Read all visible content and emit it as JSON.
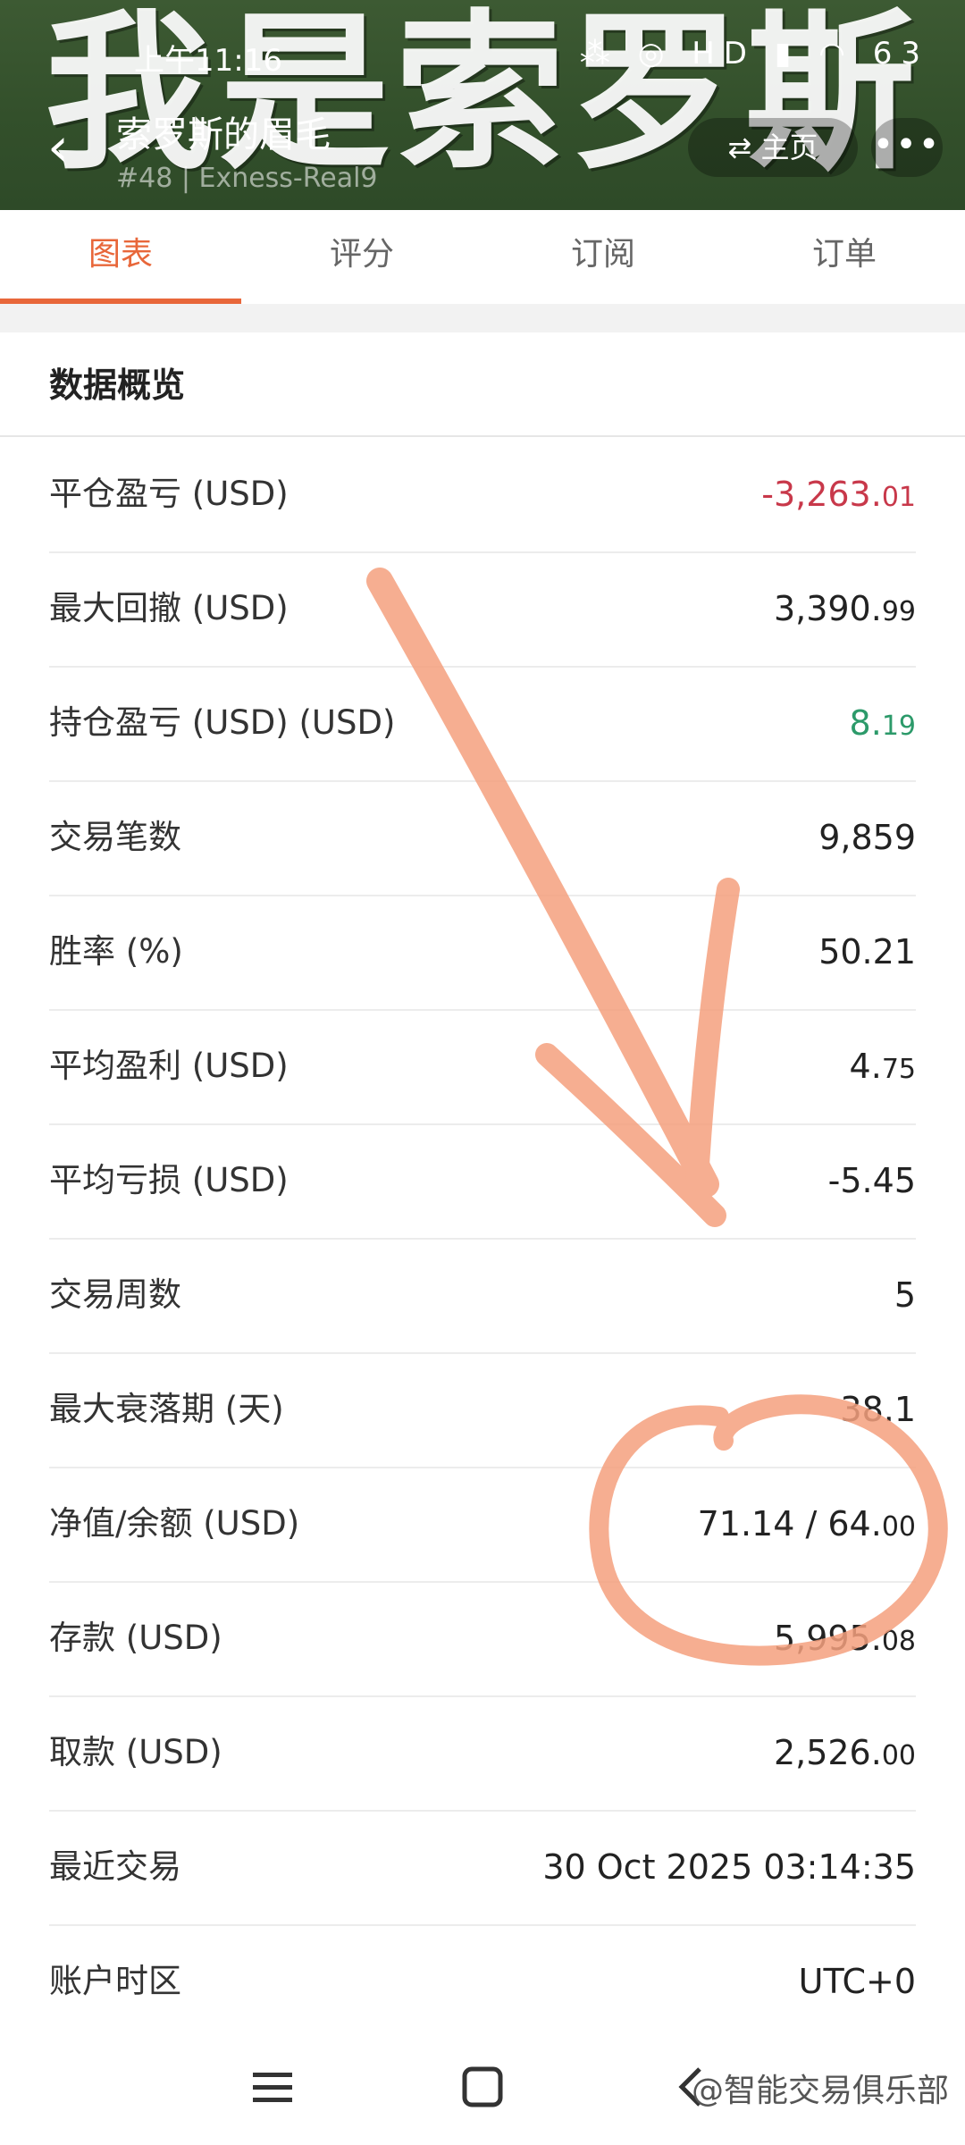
{
  "header": {
    "watermark": "我是索罗斯",
    "status_time": "上午11:16",
    "status_icons": "⁂ ◎ HD ▮ ◠ 63",
    "title": "索罗斯的眉毛",
    "subtitle": "#48 | Exness-Real9",
    "home_label": "主页",
    "more_label": "•••",
    "back_icon": "chevron-left-icon"
  },
  "tabs": [
    {
      "label": "图表",
      "active": true
    },
    {
      "label": "评分",
      "active": false
    },
    {
      "label": "订阅",
      "active": false
    },
    {
      "label": "订单",
      "active": false
    }
  ],
  "overview": {
    "title": "数据概览",
    "rows": [
      {
        "label": "平仓盈亏 (USD)",
        "value_int": "-3,263.",
        "value_dec": "01",
        "color": "#c8384a"
      },
      {
        "label": "最大回撤 (USD)",
        "value_int": "3,390.",
        "value_dec": "99",
        "color": "#222222"
      },
      {
        "label": "持仓盈亏 (USD) (USD)",
        "value_int": "8.",
        "value_dec": "19",
        "color": "#2c9a6a"
      },
      {
        "label": "交易笔数",
        "value_int": "9,859",
        "value_dec": "",
        "color": "#222222"
      },
      {
        "label": "胜率 (%)",
        "value_int": "50.21",
        "value_dec": "",
        "color": "#222222"
      },
      {
        "label": "平均盈利 (USD)",
        "value_int": "4.",
        "value_dec": "75",
        "color": "#222222"
      },
      {
        "label": "平均亏损 (USD)",
        "value_int": "-5.45",
        "value_dec": "",
        "color": "#222222"
      },
      {
        "label": "交易周数",
        "value_int": "5",
        "value_dec": "",
        "color": "#222222"
      },
      {
        "label": "最大衰落期 (天)",
        "value_int": "38.1",
        "value_dec": "",
        "color": "#222222"
      },
      {
        "label": "净值/余额 (USD)",
        "value_int": "71.14 / 64.",
        "value_dec": "00",
        "color": "#222222"
      },
      {
        "label": "存款 (USD)",
        "value_int": "5,995.",
        "value_dec": "08",
        "color": "#222222"
      },
      {
        "label": "取款 (USD)",
        "value_int": "2,526.",
        "value_dec": "00",
        "color": "#222222"
      },
      {
        "label": "最近交易",
        "value_int": "30 Oct 2025 03:14:35",
        "value_dec": "",
        "color": "#222222"
      },
      {
        "label": "账户时区",
        "value_int": "UTC+0",
        "value_dec": "",
        "color": "#222222"
      }
    ]
  },
  "annotation_color": "#f5a07e",
  "navbar": {
    "items": [
      "menu-icon",
      "home-icon",
      "back-icon"
    ]
  },
  "brand_watermark": "@智能交易俱乐部"
}
